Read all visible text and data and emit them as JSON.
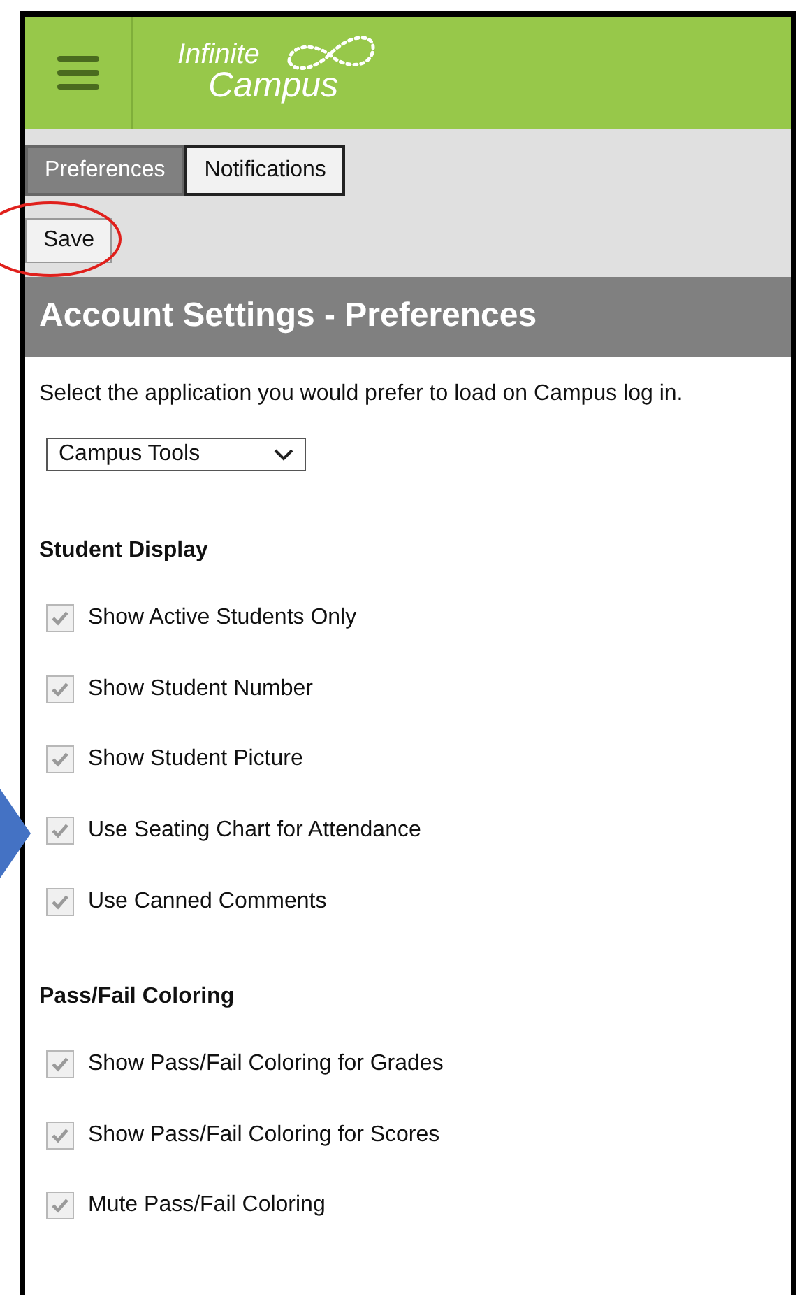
{
  "header": {
    "logo": [
      "Infinite",
      "Campus"
    ]
  },
  "tabs": [
    {
      "label": "Preferences",
      "selected": true
    },
    {
      "label": "Notifications",
      "selected": false
    }
  ],
  "save_button": "Save",
  "section_title": "Account Settings - Preferences",
  "intro": "Select the application you would prefer to load on Campus log in.",
  "app_select": {
    "value": "Campus Tools"
  },
  "groups": [
    {
      "title": "Student Display",
      "options": [
        {
          "label": "Show Active Students Only",
          "checked": true
        },
        {
          "label": "Show Student Number",
          "checked": true
        },
        {
          "label": "Show Student Picture",
          "checked": true
        },
        {
          "label": "Use Seating Chart for Attendance",
          "checked": true
        },
        {
          "label": "Use Canned Comments",
          "checked": true
        }
      ]
    },
    {
      "title": "Pass/Fail Coloring",
      "options": [
        {
          "label": "Show Pass/Fail Coloring for Grades",
          "checked": true
        },
        {
          "label": "Show Pass/Fail Coloring for Scores",
          "checked": true
        },
        {
          "label": "Mute Pass/Fail Coloring",
          "checked": true
        }
      ]
    }
  ]
}
